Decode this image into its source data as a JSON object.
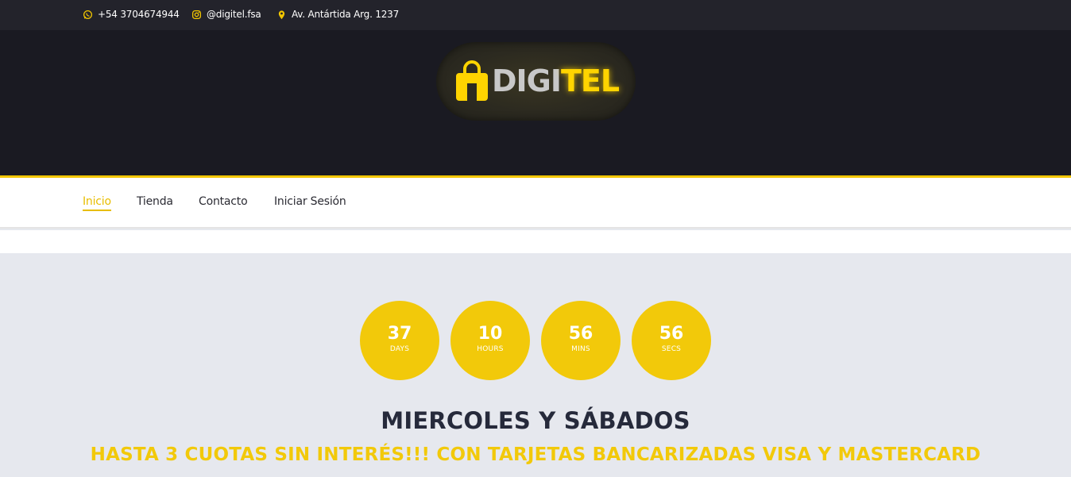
{
  "topbar": {
    "phone": "+54 3704674944",
    "instagram": "@digitel.fsa",
    "address": "Av. Antártida Arg. 1237",
    "icons": {
      "phone": "whatsapp-icon",
      "instagram": "instagram-icon",
      "address": "map-pin-icon"
    }
  },
  "logo": {
    "part1": "DIGI",
    "part2": "TEL",
    "icon": "shopping-bag-icon"
  },
  "nav": {
    "items": [
      {
        "label": "Inicio",
        "active": true
      },
      {
        "label": "Tienda",
        "active": false
      },
      {
        "label": "Contacto",
        "active": false
      },
      {
        "label": "Iniciar Sesión",
        "active": false
      }
    ]
  },
  "countdown": [
    {
      "value": "37",
      "unit": "DAYS"
    },
    {
      "value": "10",
      "unit": "HOURS"
    },
    {
      "value": "56",
      "unit": "MINS"
    },
    {
      "value": "56",
      "unit": "SECS"
    }
  ],
  "promo": {
    "headline": "MIERCOLES Y SÁBADOS",
    "subline": "HASTA 3 CUOTAS SIN INTERÉS!!! CON TARJETAS BANCARIZADAS VISA Y MASTERCARD"
  },
  "colors": {
    "accent": "#f2c90a",
    "dark": "#1a1a22",
    "topbar": "#23232b",
    "background": "#e6e8ee"
  }
}
